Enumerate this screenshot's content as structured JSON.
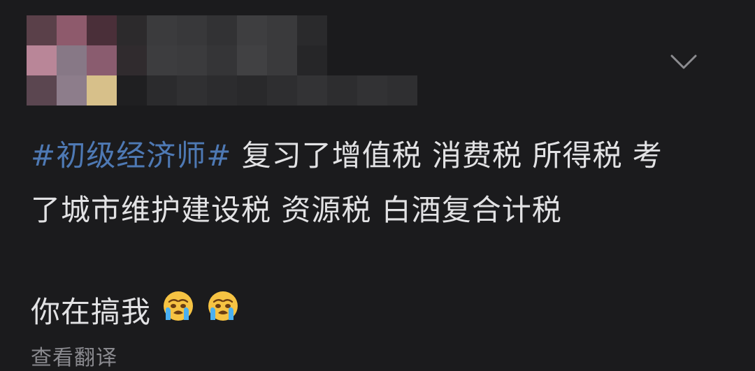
{
  "post": {
    "hashtag": "#初级经济师#",
    "line1_rest": " 复习了增值税 消费税 所得税 考",
    "line2": "了城市维护建设税 资源税 白酒复合计税",
    "line3": "你在搞我"
  },
  "emojis": [
    "crying-face",
    "crying-face"
  ],
  "actions": {
    "translate_label": "查看翻译"
  },
  "icons": {
    "expand": "chevron-down-icon"
  },
  "colors": {
    "background": "#1b1b1d",
    "text": "#e2e2e4",
    "hashtag": "#4e79b4",
    "secondary": "#8a8a8f"
  }
}
